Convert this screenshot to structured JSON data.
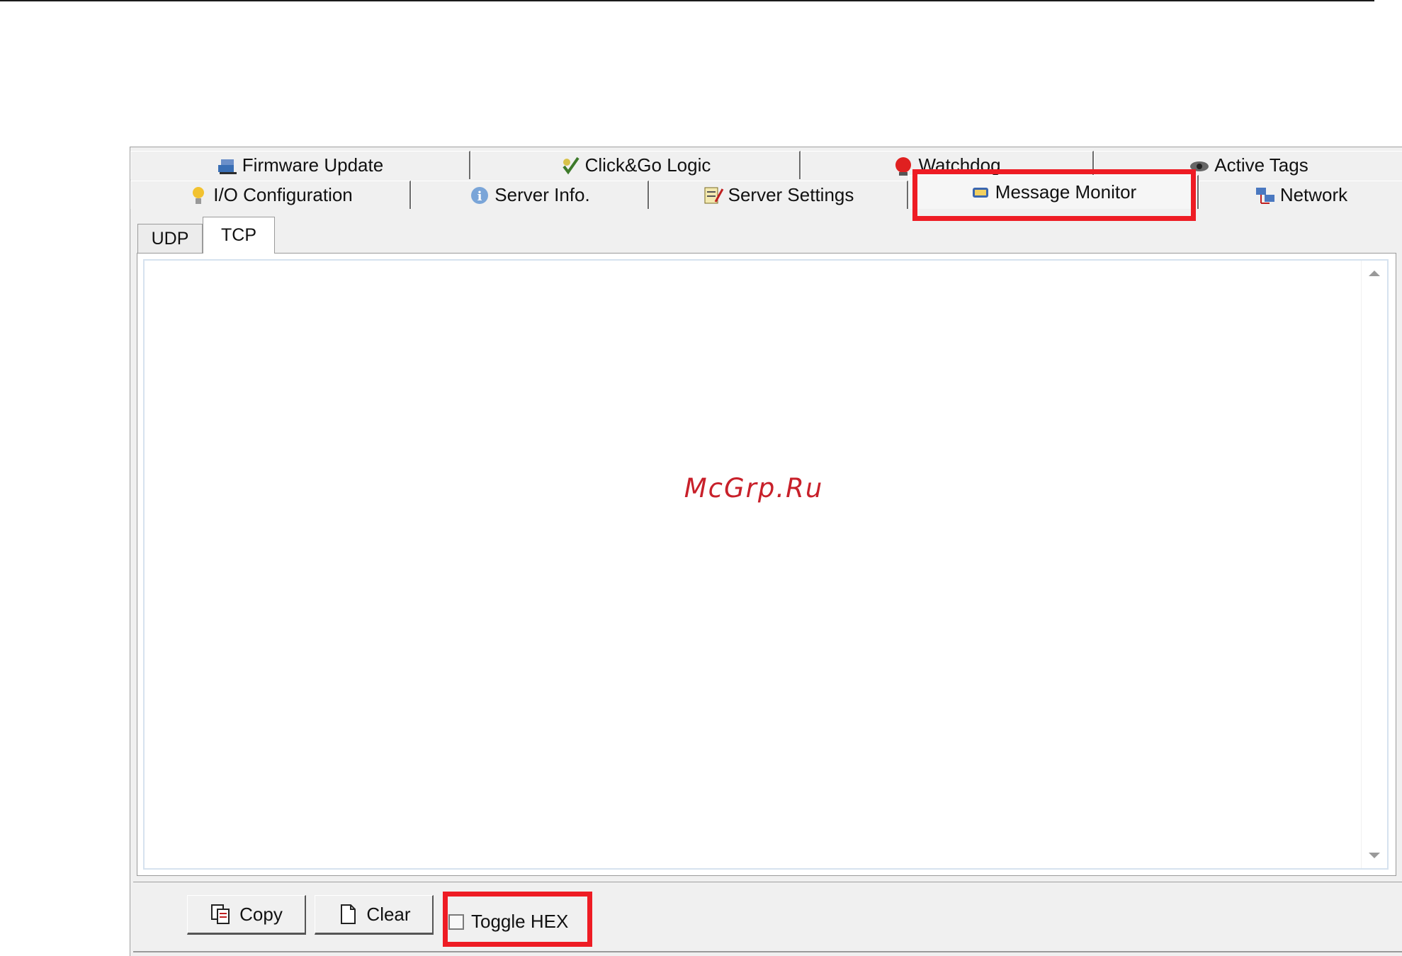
{
  "tabs_row1": [
    {
      "label": "Firmware Update",
      "icon": "firmware-update-icon"
    },
    {
      "label": "Click&Go Logic",
      "icon": "click-go-logic-icon"
    },
    {
      "label": "Watchdog",
      "icon": "watchdog-icon"
    },
    {
      "label": "Active Tags",
      "icon": "active-tags-icon"
    }
  ],
  "tabs_row2": [
    {
      "label": "I/O Configuration",
      "icon": "bulb-icon"
    },
    {
      "label": "Server Info.",
      "icon": "info-icon"
    },
    {
      "label": "Server Settings",
      "icon": "server-settings-icon"
    },
    {
      "label": "Message Monitor",
      "icon": "message-monitor-icon",
      "selected": true
    },
    {
      "label": "Network",
      "icon": "network-icon"
    }
  ],
  "subtabs": [
    {
      "label": "UDP"
    },
    {
      "label": "TCP",
      "selected": true
    }
  ],
  "watermark": "McGrp.Ru",
  "buttons": {
    "copy": "Copy",
    "clear": "Clear"
  },
  "toggle_hex": {
    "label": "Toggle HEX",
    "checked": false
  },
  "colors": {
    "highlight": "#ee1c24",
    "panel_bg": "#f0f0f0",
    "watermark": "#c8202a"
  }
}
